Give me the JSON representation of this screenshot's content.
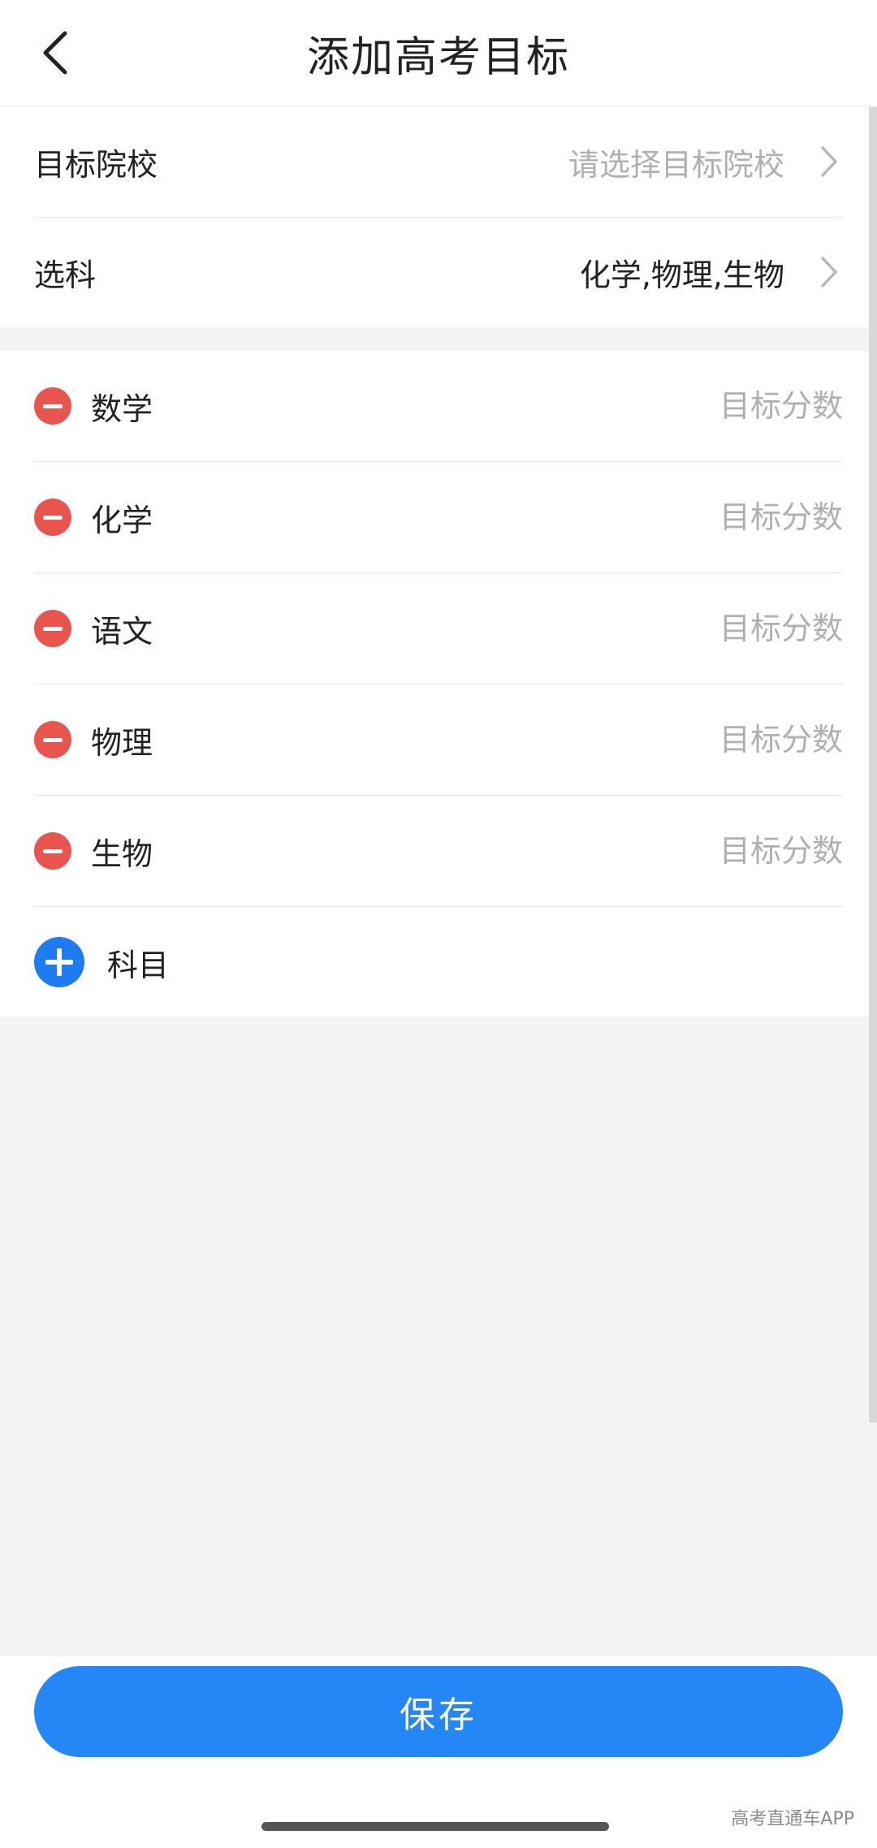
{
  "header": {
    "title": "添加高考目标",
    "back_icon": "chevron-left-icon"
  },
  "form": {
    "target_school": {
      "label": "目标院校",
      "placeholder": "请选择目标院校"
    },
    "subject_selection": {
      "label": "选科",
      "value": "化学,物理,生物"
    }
  },
  "subjects": [
    {
      "name": "数学",
      "score_placeholder": "目标分数"
    },
    {
      "name": "化学",
      "score_placeholder": "目标分数"
    },
    {
      "name": "语文",
      "score_placeholder": "目标分数"
    },
    {
      "name": "物理",
      "score_placeholder": "目标分数"
    },
    {
      "name": "生物",
      "score_placeholder": "目标分数"
    }
  ],
  "add_subject": {
    "label": "科目"
  },
  "footer": {
    "save_label": "保存",
    "watermark": "高考直通车APP"
  },
  "colors": {
    "accent_blue": "#2586f5",
    "remove_red": "#e8554f",
    "placeholder_gray": "#b0b0b0"
  }
}
